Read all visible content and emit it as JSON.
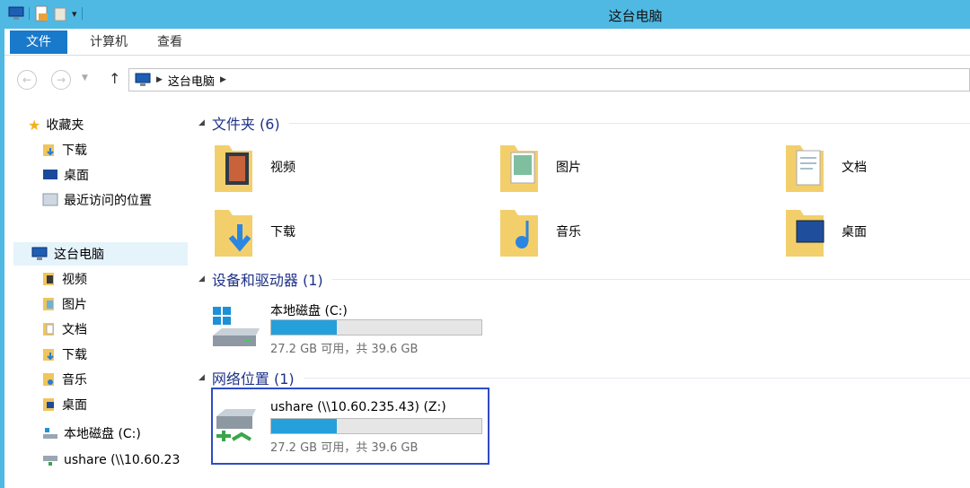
{
  "window": {
    "title": "这台电脑",
    "accent": "#4fb9e3"
  },
  "ribbon": {
    "tabs": [
      "文件",
      "计算机",
      "查看"
    ]
  },
  "address": {
    "path": [
      "这台电脑"
    ]
  },
  "sidebar": {
    "favorites": {
      "label": "收藏夹",
      "items": [
        "下载",
        "桌面",
        "最近访问的位置"
      ]
    },
    "this_pc": {
      "label": "这台电脑",
      "items": [
        "视频",
        "图片",
        "文档",
        "下载",
        "音乐",
        "桌面",
        "本地磁盘 (C:)",
        "ushare (\\\\10.60.23"
      ]
    }
  },
  "content": {
    "groups": [
      "文件夹 (6)",
      "设备和驱动器 (1)",
      "网络位置 (1)"
    ],
    "folders": [
      "视频",
      "图片",
      "文档",
      "下载",
      "音乐",
      "桌面"
    ],
    "drives": [
      {
        "name": "本地磁盘 (C:)",
        "stat": "27.2 GB 可用，共 39.6 GB",
        "used_fraction": 0.31,
        "color": "#26a0da"
      }
    ],
    "network": [
      {
        "name": "ushare (\\\\10.60.235.43) (Z:)",
        "stat": "27.2 GB 可用，共 39.6 GB",
        "used_fraction": 0.31,
        "color": "#26a0da"
      }
    ]
  }
}
